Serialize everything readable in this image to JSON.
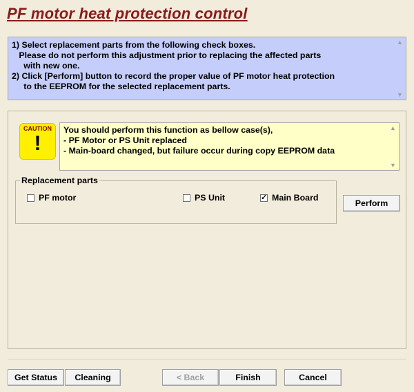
{
  "title": "PF motor heat protection control",
  "instructions": {
    "text": "1) Select replacement parts from the following check boxes.\n   Please do not perform this adjustment prior to replacing the affected parts\n     with new one.\n2) Click [Perform] button to record the proper value of PF motor heat protection\n     to the EEPROM for the selected replacement parts."
  },
  "caution": {
    "label": "CAUTION",
    "mark": "!",
    "text": "You should perform this function as bellow case(s),\n- PF Motor or PS Unit replaced\n- Main-board changed, but failure occur during copy EEPROM data"
  },
  "replacement_parts": {
    "legend": "Replacement parts",
    "items": [
      {
        "label": "PF motor",
        "checked": false
      },
      {
        "label": "PS Unit",
        "checked": false
      },
      {
        "label": "Main Board",
        "checked": true
      }
    ]
  },
  "buttons": {
    "perform": "Perform",
    "get_status": "Get Status",
    "cleaning": "Cleaning",
    "back": "< Back",
    "finish": "Finish",
    "cancel": "Cancel"
  },
  "icons": {
    "scroll_up": "scroll-up-icon",
    "scroll_down": "scroll-down-icon",
    "caution": "caution-icon",
    "checkbox_checked": "checkmark-icon"
  },
  "colors": {
    "background": "#f1ecdc",
    "title": "#8b1a1a",
    "instructions_bg": "#c5cdfa",
    "caution_box_bg": "#ffffc8",
    "caution_icon": "#ffef00"
  }
}
